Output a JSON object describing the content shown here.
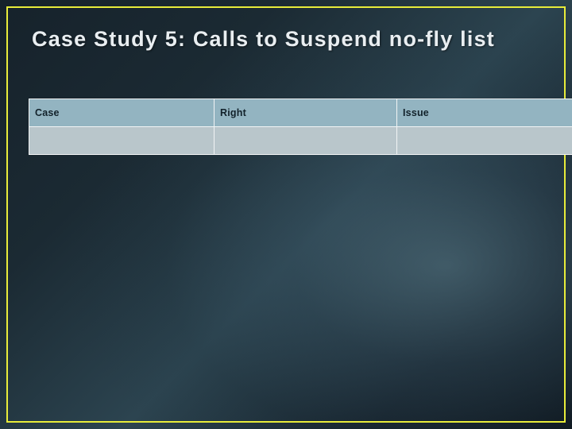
{
  "slide": {
    "title": "Case Study 5: Calls to Suspend no-fly list",
    "border_color": "#e8ec3a",
    "table": {
      "headers": [
        "Case",
        "Right",
        "Issue"
      ],
      "rows": [
        [
          "",
          "",
          ""
        ]
      ]
    }
  }
}
